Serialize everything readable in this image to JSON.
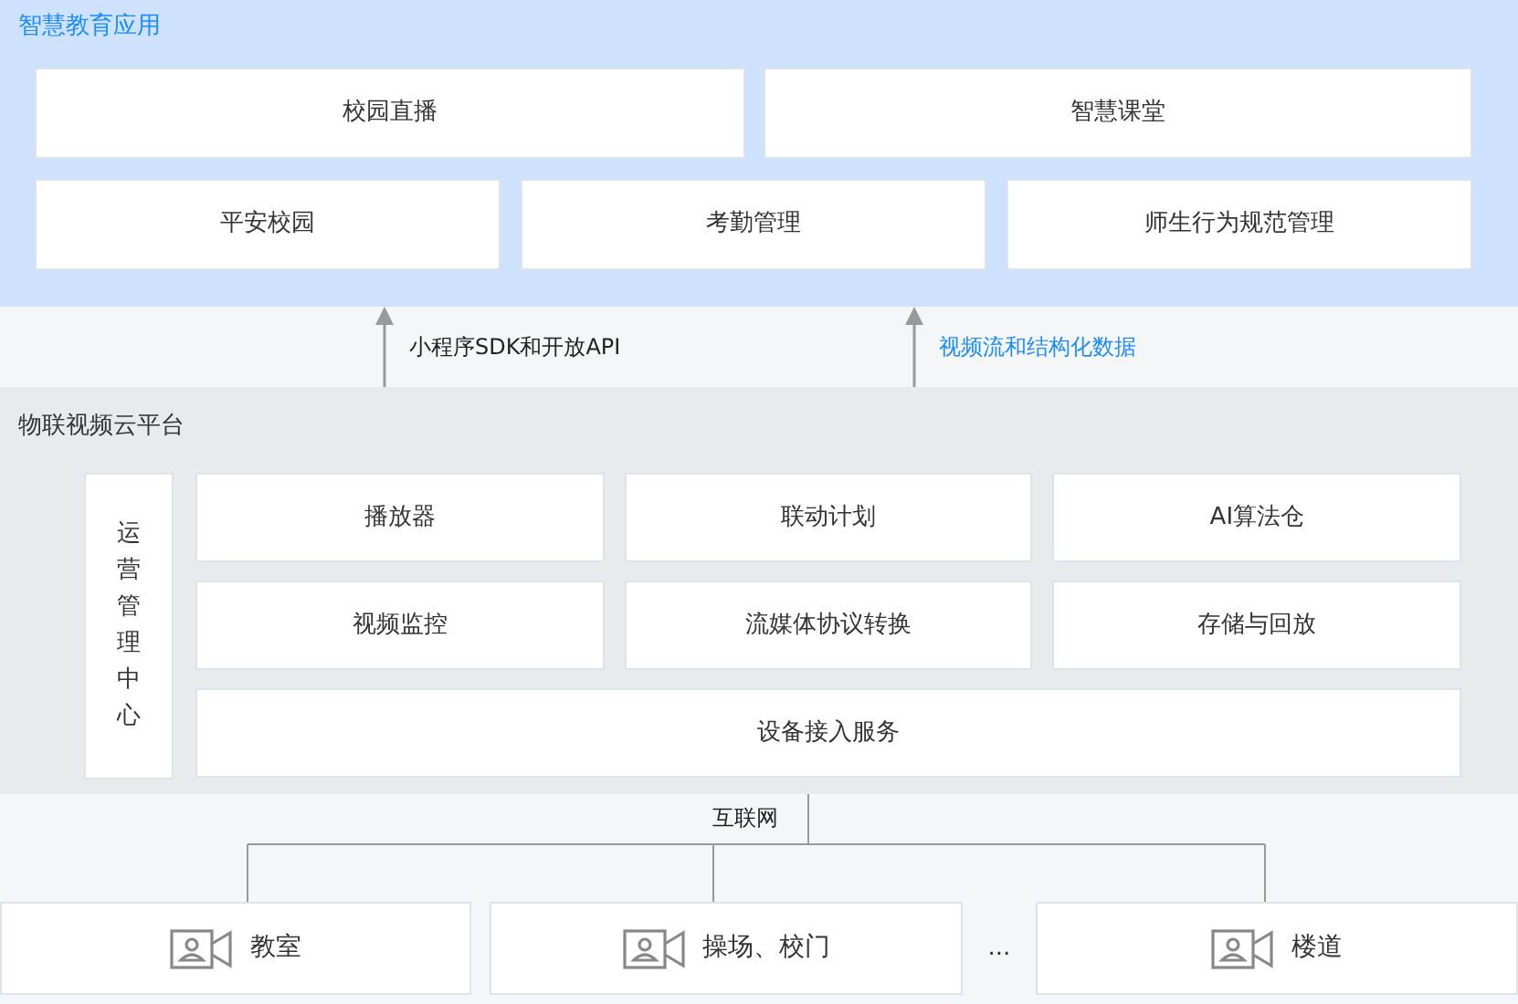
{
  "applications": {
    "title": "智慧教育应用",
    "rows": [
      [
        "校园直播",
        "智慧课堂"
      ],
      [
        "平安校园",
        "考勤管理",
        "师生行为规范管理"
      ]
    ]
  },
  "data_flows": [
    {
      "label": "小程序SDK和开放API",
      "color": "#222222"
    },
    {
      "label": "视频流和结构化数据",
      "color": "#1a8cff"
    }
  ],
  "platform": {
    "title": "物联视频云平台",
    "side_panel": "运营管理中心",
    "modules": [
      "播放器",
      "联动计划",
      "AI算法仓",
      "视频监控",
      "流媒体协议转换",
      "存储与回放"
    ],
    "base_module": "设备接入服务"
  },
  "network": {
    "label": "互联网",
    "ellipsis": "...",
    "devices": [
      {
        "label": "教室"
      },
      {
        "label": "操场、校门"
      },
      {
        "label": "楼道"
      }
    ]
  }
}
